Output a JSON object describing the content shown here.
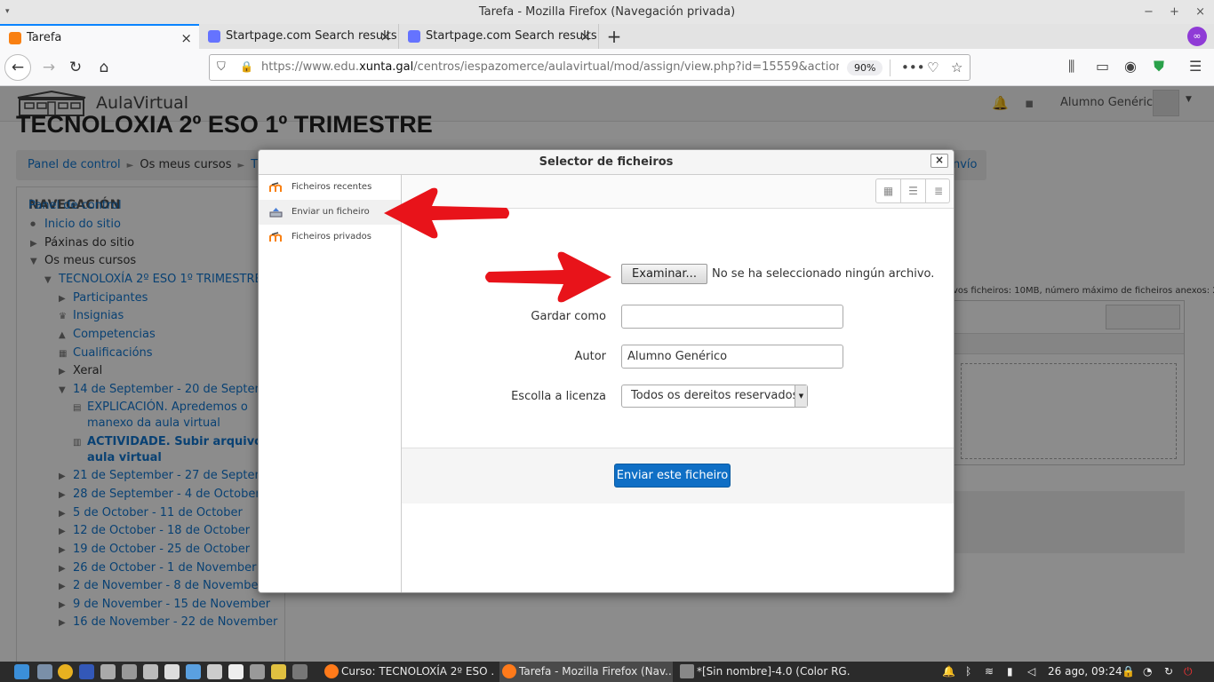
{
  "window": {
    "title": "Tarefa - Mozilla Firefox (Navegación privada)",
    "menu_icon": "▾",
    "controls": [
      "−",
      "+",
      "×"
    ]
  },
  "tabs": [
    {
      "label": "Tarefa",
      "icon": "moodle-icon",
      "color": "#f98012"
    },
    {
      "label": "Startpage.com Search results",
      "icon": "startpage-icon",
      "color": "#6573ff"
    },
    {
      "label": "Startpage.com Search results",
      "icon": "startpage-icon",
      "color": "#6573ff"
    }
  ],
  "new_tab": "+",
  "private_badge": "∞",
  "url": {
    "prefix": "https://www.edu.",
    "domain": "xunta.gal",
    "path": "/centros/iespazomerce/aulavirtual/mod/assign/view.php?id=15559&action=editsub",
    "zoom": "90%"
  },
  "site": {
    "name": "AulaVirtual",
    "user": "Alumno Genérico",
    "course_title": "TECNOLOXIA 2º ESO 1º TRIMESTRE",
    "breadcrumb": [
      "Panel de control",
      "Os meus cursos",
      "TEC"
    ],
    "breadcrumb_tail": "nvío"
  },
  "navigation": {
    "heading": "NAVEGACIÓN",
    "items": [
      {
        "label": "Panel de control",
        "style": "link"
      },
      {
        "label": "Inicio do sitio",
        "style": "link"
      },
      {
        "label": "Páxinas do sitio",
        "style": "text"
      },
      {
        "label": "Os meus cursos",
        "style": "text"
      },
      {
        "label": "TECNOLOXÍA 2º ESO 1º TRIMESTRE",
        "style": "link"
      },
      {
        "label": "Participantes",
        "style": "link"
      },
      {
        "label": "Insignias",
        "style": "link"
      },
      {
        "label": "Competencias",
        "style": "link"
      },
      {
        "label": "Cualificacións",
        "style": "link"
      },
      {
        "label": "Xeral",
        "style": "text"
      },
      {
        "label": "14 de September - 20 de September",
        "style": "link"
      },
      {
        "label": "EXPLICACIÓN. Apredemos o",
        "style": "link"
      },
      {
        "label": "manexo da aula virtual",
        "style": "link"
      },
      {
        "label": "ACTIVIDADE. Subir arquivos á",
        "style": "bold"
      },
      {
        "label": "aula virtual",
        "style": "bold"
      },
      {
        "label": "21 de September - 27 de September",
        "style": "link"
      },
      {
        "label": "28 de September - 4 de October",
        "style": "link"
      },
      {
        "label": "5 de October - 11 de October",
        "style": "link"
      },
      {
        "label": "12 de October - 18 de October",
        "style": "link"
      },
      {
        "label": "19 de October - 25 de October",
        "style": "link"
      },
      {
        "label": "26 de October - 1 de November",
        "style": "link"
      },
      {
        "label": "2 de November - 8 de November",
        "style": "link"
      },
      {
        "label": "9 de November - 15 de November",
        "style": "link"
      },
      {
        "label": "16 de November - 22 de November",
        "style": "link"
      }
    ]
  },
  "right_info": "vos ficheiros: 10MB, número máximo de ficheiros anexos: 2",
  "modal": {
    "title": "Selector de ficheiros",
    "close": "×",
    "repositories": [
      {
        "label": "Ficheiros recentes",
        "icon": "moodle-icon"
      },
      {
        "label": "Enviar un ficheiro",
        "icon": "upload-icon"
      },
      {
        "label": "Ficheiros privados",
        "icon": "moodle-icon"
      }
    ],
    "browse_label": "Examinar...",
    "browse_status": "No se ha seleccionado ningún archivo.",
    "save_as_label": "Gardar como",
    "save_as_value": "",
    "author_label": "Autor",
    "author_value": "Alumno Genérico",
    "license_label": "Escolla a licenza",
    "license_value": "Todos os dereitos reservados",
    "submit_label": "Enviar este ficheiro"
  },
  "taskbar": {
    "tasks": [
      {
        "label": "Curso: TECNOLOXÍA 2º ESO ..."
      },
      {
        "label": "Tarefa - Mozilla Firefox (Nav..."
      },
      {
        "label": "*[Sin nombre]-4.0 (Color RG..."
      }
    ],
    "clock": "26 ago, 09:24"
  },
  "colors": {
    "accent": "#0f6fc5",
    "link": "#1177d1",
    "arrow": "#e8131a",
    "moodle_orange": "#f98012"
  }
}
